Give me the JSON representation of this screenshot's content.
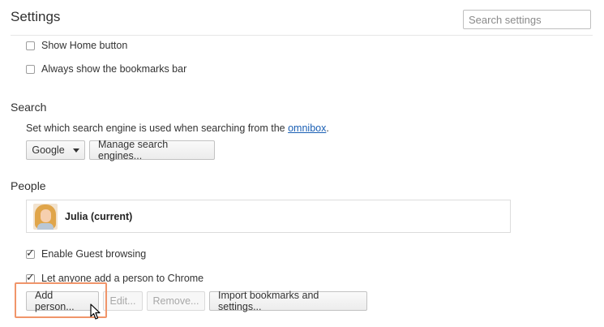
{
  "header": {
    "title": "Settings",
    "search_placeholder": "Search settings"
  },
  "appearance": {
    "show_home_button": {
      "label": "Show Home button",
      "checked": false
    },
    "show_bookmarks_bar": {
      "label": "Always show the bookmarks bar",
      "checked": false
    }
  },
  "search": {
    "title": "Search",
    "description_prefix": "Set which search engine is used when searching from the ",
    "description_link": "omnibox",
    "description_suffix": ".",
    "engine_selected": "Google",
    "manage_label": "Manage search engines..."
  },
  "people": {
    "title": "People",
    "profiles": [
      {
        "name": "Julia (current)",
        "avatar_icon": "user-photo-icon"
      }
    ],
    "enable_guest": {
      "label": "Enable Guest browsing",
      "checked": true
    },
    "let_anyone_add": {
      "label": "Let anyone add a person to Chrome",
      "checked": true
    },
    "buttons": {
      "add": "Add person...",
      "edit": "Edit...",
      "remove": "Remove...",
      "import": "Import bookmarks and settings..."
    }
  },
  "colors": {
    "highlight": "#f0956a",
    "link": "#1a5fb4"
  }
}
